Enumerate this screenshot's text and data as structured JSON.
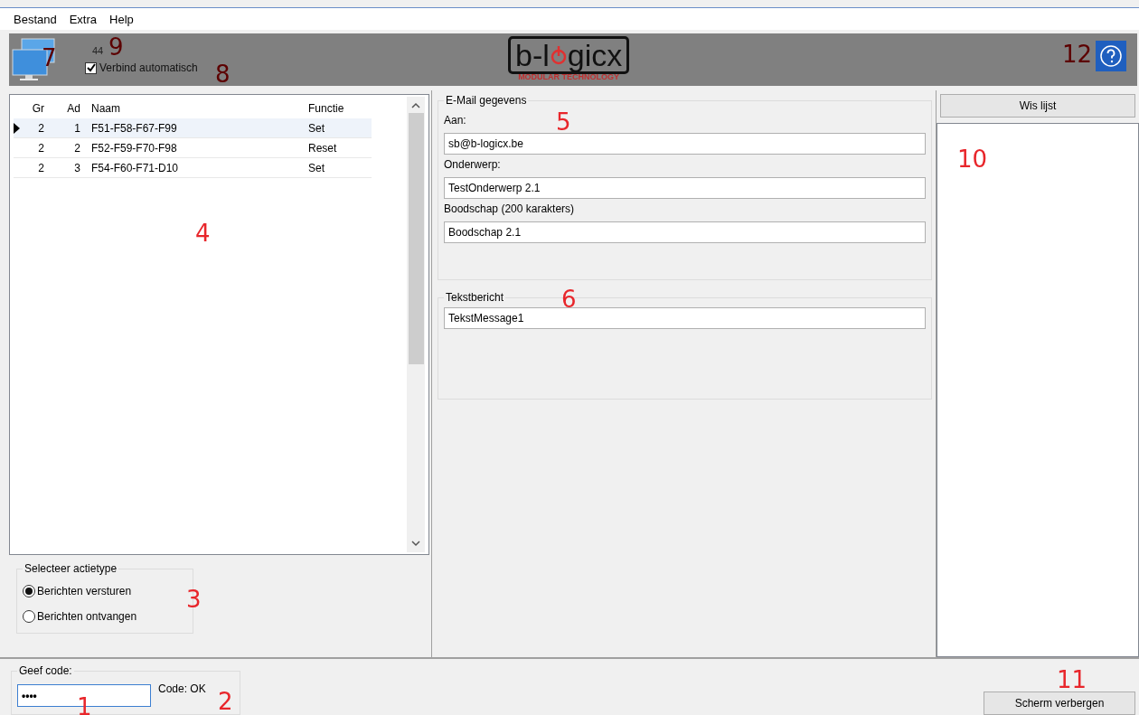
{
  "menu": [
    {
      "label": "Bestand"
    },
    {
      "label": "Extra"
    },
    {
      "label": "Help"
    }
  ],
  "header": {
    "icon_marker": "7",
    "count": "44",
    "count_marker": "9",
    "auto_connect": {
      "label": "Verbind automatisch",
      "checked": true
    },
    "auto_connect_marker": "8",
    "logo": {
      "before": "b-l",
      "after": "gicx",
      "subtitle": "MODULAR TECHNOLOGY"
    },
    "help_marker": "12"
  },
  "table": {
    "columns": [
      "Gr",
      "Ad",
      "Naam",
      "Functie"
    ],
    "marker": "4",
    "rows": [
      {
        "cells": [
          "2",
          "1",
          "F51-F58-F67-F99",
          "Set"
        ],
        "selected": true
      },
      {
        "cells": [
          "2",
          "2",
          "F52-F59-F70-F98",
          "Reset"
        ],
        "selected": false
      },
      {
        "cells": [
          "2",
          "3",
          "F54-F60-F71-D10",
          "Set"
        ],
        "selected": false
      }
    ]
  },
  "action_type": {
    "title": "Selecteer actietype",
    "marker": "3",
    "options": [
      {
        "label": "Berichten versturen",
        "selected": true
      },
      {
        "label": "Berichten ontvangen",
        "selected": false
      }
    ]
  },
  "email": {
    "title": "E-Mail gegevens",
    "marker": "5",
    "fields": [
      {
        "label": "Aan:",
        "value": "sb@b-logicx.be"
      },
      {
        "label": "Onderwerp:",
        "value": "TestOnderwerp 2.1"
      },
      {
        "label": "Boodschap (200 karakters)",
        "value": "Boodschap 2.1"
      }
    ]
  },
  "sms": {
    "title": "Tekstbericht",
    "marker": "6",
    "value": "TekstMessage1"
  },
  "log": {
    "button": "Wis lijst",
    "marker": "10"
  },
  "code": {
    "title": "Geef code:",
    "value": "••••",
    "marker": "1",
    "status": "Code: OK",
    "status_marker": "2"
  },
  "hide_button": {
    "label": "Scherm verbergen",
    "marker": "11"
  }
}
